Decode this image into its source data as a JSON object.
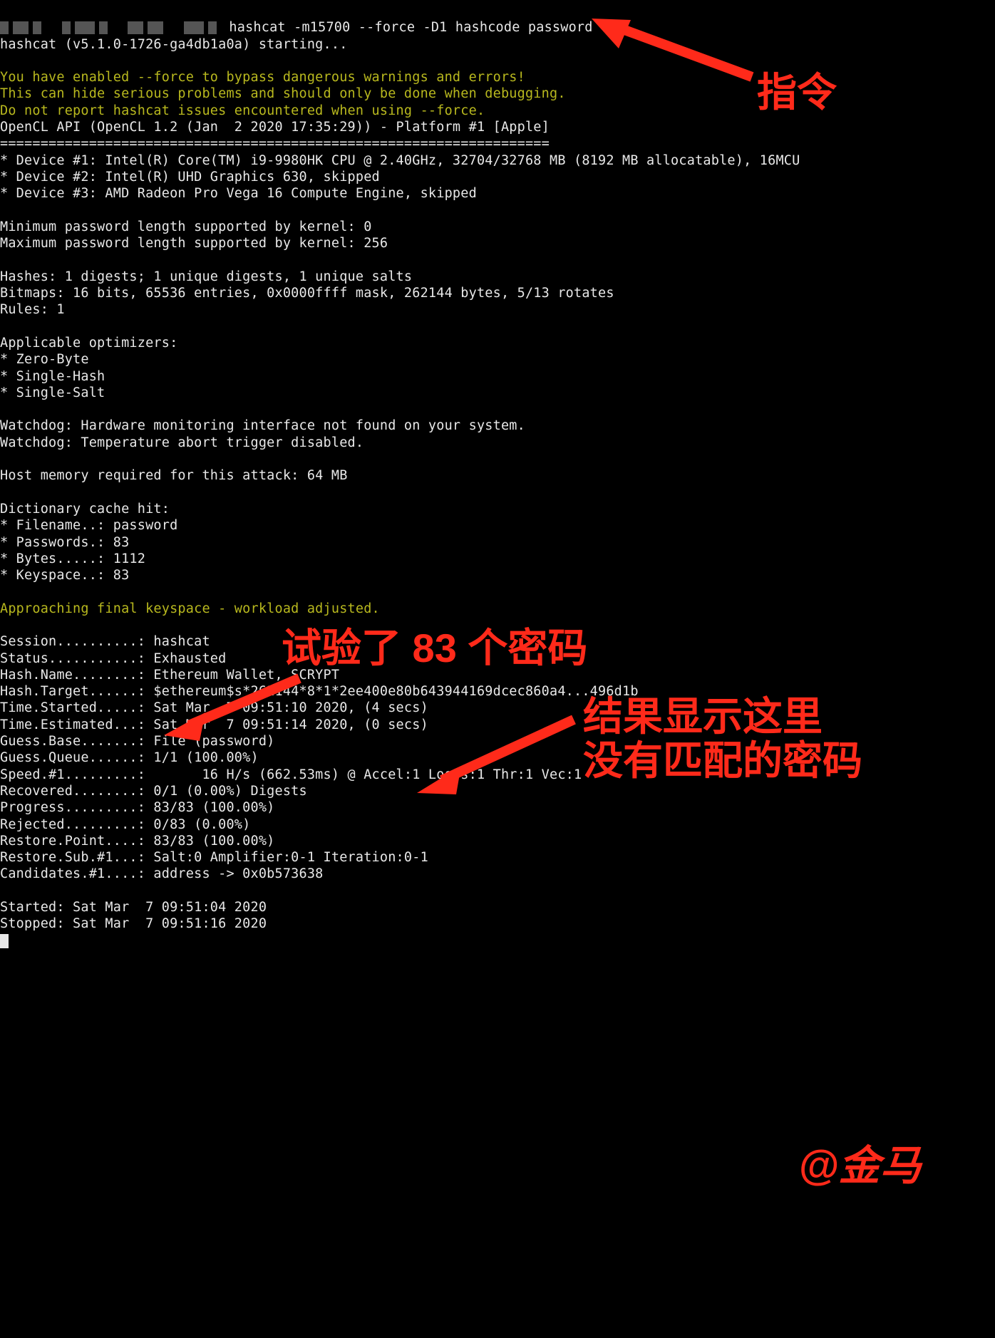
{
  "command": " hashcat -m15700 --force -D1 hashcode password",
  "starting": "hashcat (v5.1.0-1726-ga4db1a0a) starting...",
  "warn1": "You have enabled --force to bypass dangerous warnings and errors!",
  "warn2": "This can hide serious problems and should only be done when debugging.",
  "warn3": "Do not report hashcat issues encountered when using --force.",
  "opencl": "OpenCL API (OpenCL 1.2 (Jan  2 2020 17:35:29)) - Platform #1 [Apple]",
  "sep": "====================================================================",
  "dev1": "* Device #1: Intel(R) Core(TM) i9-9980HK CPU @ 2.40GHz, 32704/32768 MB (8192 MB allocatable), 16MCU",
  "dev2": "* Device #2: Intel(R) UHD Graphics 630, skipped",
  "dev3": "* Device #3: AMD Radeon Pro Vega 16 Compute Engine, skipped",
  "minp": "Minimum password length supported by kernel: 0",
  "maxp": "Maximum password length supported by kernel: 256",
  "hashes": "Hashes: 1 digests; 1 unique digests, 1 unique salts",
  "bitmaps": "Bitmaps: 16 bits, 65536 entries, 0x0000ffff mask, 262144 bytes, 5/13 rotates",
  "rules": "Rules: 1",
  "opt_h": "Applicable optimizers:",
  "opt1": "* Zero-Byte",
  "opt2": "* Single-Hash",
  "opt3": "* Single-Salt",
  "wd1": "Watchdog: Hardware monitoring interface not found on your system.",
  "wd2": "Watchdog: Temperature abort trigger disabled.",
  "hostmem": "Host memory required for this attack: 64 MB",
  "dch": "Dictionary cache hit:",
  "dc1": "* Filename..: password",
  "dc2": "* Passwords.: 83",
  "dc3": "* Bytes.....: 1112",
  "dc4": "* Keyspace..: 83",
  "approach": "Approaching final keyspace - workload adjusted.",
  "s_session": "Session..........: hashcat",
  "s_status": "Status...........: Exhausted",
  "s_hashname": "Hash.Name........: Ethereum Wallet, SCRYPT",
  "s_target": "Hash.Target......: $ethereum$s*262144*8*1*2ee400e80b643944169dcec860a4...496d1b",
  "s_started": "Time.Started.....: Sat Mar  7 09:51:10 2020, (4 secs)",
  "s_est": "Time.Estimated...: Sat Mar  7 09:51:14 2020, (0 secs)",
  "s_gbase": "Guess.Base.......: File (password)",
  "s_gqueue": "Guess.Queue......: 1/1 (100.00%)",
  "s_speed": "Speed.#1.........:       16 H/s (662.53ms) @ Accel:1 Loops:1 Thr:1 Vec:1",
  "s_rec": "Recovered........: 0/1 (0.00%) Digests",
  "s_prog": "Progress.........: 83/83 (100.00%)",
  "s_rej": "Rejected.........: 0/83 (0.00%)",
  "s_rp": "Restore.Point....: 83/83 (100.00%)",
  "s_rs": "Restore.Sub.#1...: Salt:0 Amplifier:0-1 Iteration:0-1",
  "s_cand": "Candidates.#1....: address -> 0x0b573638",
  "started": "Started: Sat Mar  7 09:51:04 2020",
  "stopped": "Stopped: Sat Mar  7 09:51:16 2020",
  "ann_cmd": "指令",
  "ann_tried": "试验了 83 个密码",
  "ann_result1": "结果显示这里",
  "ann_result2": "没有匹配的密码",
  "watermark": "@金马",
  "colors": {
    "fg": "#e8e8e8",
    "yellow": "#b8b81e",
    "red": "#ff2a1a",
    "bg": "#000000"
  }
}
